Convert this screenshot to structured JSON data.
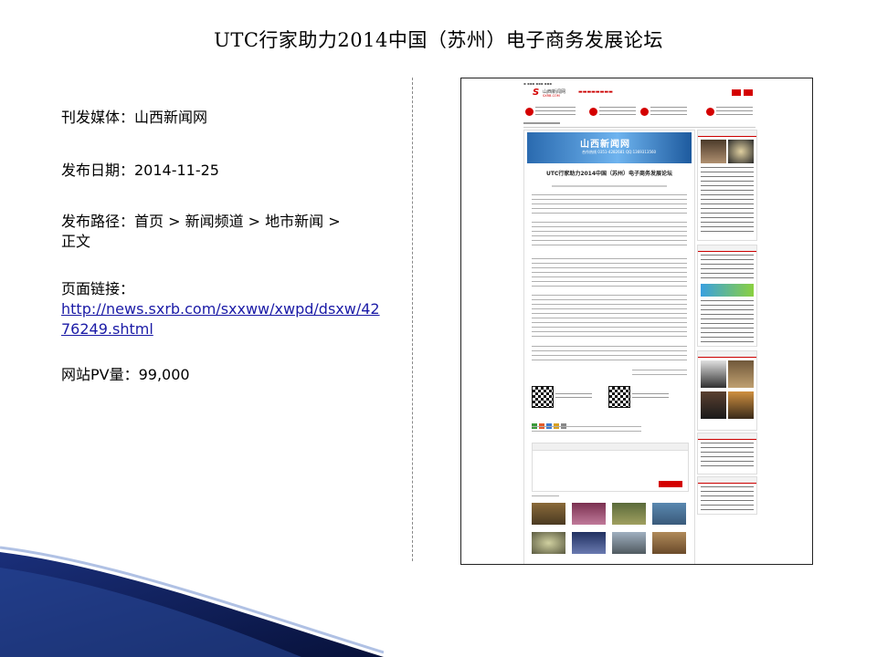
{
  "title": "UTC行家助力2014中国（苏州）电子商务发展论坛",
  "info": {
    "media": "刊发媒体：山西新闻网",
    "date": "发布日期：2014-11-25",
    "path_line1": "发布路径：首页 > 新闻频道 > 地市新闻 >",
    "path_line2": "正文",
    "link_label": "页面链接：",
    "link_line1": "http://news.sxrb.com/sxxww/xwpd/dsxw/42",
    "link_line2": "76249.shtml",
    "pv": "网站PV量：99,000"
  },
  "screenshot": {
    "site_logo": "山西新闻网",
    "site_logo_en": "SXRB.COM",
    "banner_title": "山西新闻网",
    "banner_sub": "合作热线 0351-4282681 QQ:1369313560",
    "article_title": "UTC行家助力2014中国（苏州）电子商务发展论坛"
  },
  "colors": {
    "accent_red": "#d40000",
    "link_blue": "#1a1aa6",
    "wave_dark": "#0d1f5c"
  }
}
